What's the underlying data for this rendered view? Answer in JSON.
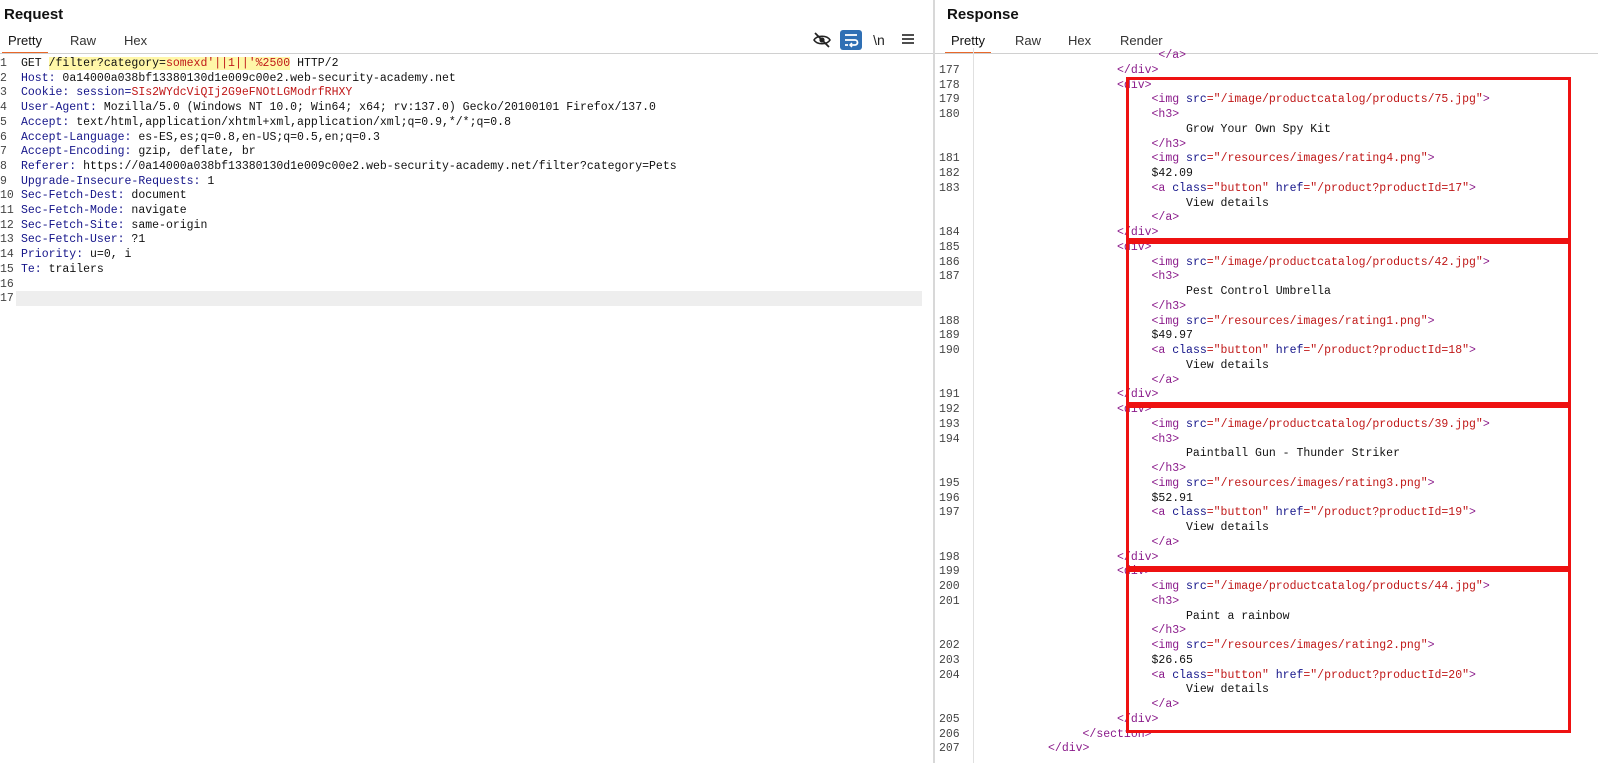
{
  "request": {
    "title": "Request",
    "tabs": [
      "Pretty",
      "Raw",
      "Hex"
    ],
    "active_tab": "Pretty",
    "tools": {
      "hide_icon": "eye-slash-icon",
      "wrap_icon": "wrap-lines-icon",
      "newline_label": "\\n",
      "menu_icon": "hamburger-menu-icon"
    },
    "lines": [
      {
        "n": "1",
        "parts": [
          {
            "t": "GET ",
            "c": "v"
          },
          {
            "t": "/filter?category=",
            "c": "v hi"
          },
          {
            "t": "somexd'||1||'%2500",
            "c": "r hi"
          },
          {
            "t": " HTTP/2",
            "c": "v"
          }
        ]
      },
      {
        "n": "2",
        "parts": [
          {
            "t": "Host:",
            "c": "k"
          },
          {
            "t": " 0a14000a038bf13380130d1e009c00e2.web-security-academy.net",
            "c": "v"
          }
        ]
      },
      {
        "n": "3",
        "parts": [
          {
            "t": "Cookie:",
            "c": "k"
          },
          {
            "t": " session=",
            "c": "k"
          },
          {
            "t": "SIs2WYdcViQIj2G9eFNOtLGModrfRHXY",
            "c": "r"
          }
        ]
      },
      {
        "n": "4",
        "parts": [
          {
            "t": "User-Agent:",
            "c": "k"
          },
          {
            "t": " Mozilla/5.0 (Windows NT 10.0; Win64; x64; rv:137.0) Gecko/20100101 Firefox/137.0",
            "c": "v"
          }
        ]
      },
      {
        "n": "5",
        "parts": [
          {
            "t": "Accept:",
            "c": "k"
          },
          {
            "t": " text/html,application/xhtml+xml,application/xml;q=0.9,*/*;q=0.8",
            "c": "v"
          }
        ]
      },
      {
        "n": "6",
        "parts": [
          {
            "t": "Accept-Language:",
            "c": "k"
          },
          {
            "t": " es-ES,es;q=0.8,en-US;q=0.5,en;q=0.3",
            "c": "v"
          }
        ]
      },
      {
        "n": "7",
        "parts": [
          {
            "t": "Accept-Encoding:",
            "c": "k"
          },
          {
            "t": " gzip, deflate, br",
            "c": "v"
          }
        ]
      },
      {
        "n": "8",
        "parts": [
          {
            "t": "Referer:",
            "c": "k"
          },
          {
            "t": " https://0a14000a038bf13380130d1e009c00e2.web-security-academy.net/filter?category=Pets",
            "c": "v"
          }
        ]
      },
      {
        "n": "9",
        "parts": [
          {
            "t": "Upgrade-Insecure-Requests:",
            "c": "k"
          },
          {
            "t": " 1",
            "c": "v"
          }
        ]
      },
      {
        "n": "10",
        "parts": [
          {
            "t": "Sec-Fetch-Dest:",
            "c": "k"
          },
          {
            "t": " document",
            "c": "v"
          }
        ]
      },
      {
        "n": "11",
        "parts": [
          {
            "t": "Sec-Fetch-Mode:",
            "c": "k"
          },
          {
            "t": " navigate",
            "c": "v"
          }
        ]
      },
      {
        "n": "12",
        "parts": [
          {
            "t": "Sec-Fetch-Site:",
            "c": "k"
          },
          {
            "t": " same-origin",
            "c": "v"
          }
        ]
      },
      {
        "n": "13",
        "parts": [
          {
            "t": "Sec-Fetch-User:",
            "c": "k"
          },
          {
            "t": " ?1",
            "c": "v"
          }
        ]
      },
      {
        "n": "14",
        "parts": [
          {
            "t": "Priority:",
            "c": "k"
          },
          {
            "t": " u=0, i",
            "c": "v"
          }
        ]
      },
      {
        "n": "15",
        "parts": [
          {
            "t": "Te:",
            "c": "k"
          },
          {
            "t": " trailers",
            "c": "v"
          }
        ]
      },
      {
        "n": "16",
        "parts": []
      },
      {
        "n": "17",
        "parts": []
      }
    ]
  },
  "response": {
    "title": "Response",
    "tabs": [
      "Pretty",
      "Raw",
      "Hex",
      "Render"
    ],
    "active_tab": "Pretty",
    "lines": [
      {
        "n": "",
        "parts": [
          {
            "t": "                          </",
            "c": "tag"
          },
          {
            "t": "a",
            "c": "tag"
          },
          {
            "t": ">",
            "c": "tag"
          }
        ]
      },
      {
        "n": "177",
        "parts": [
          {
            "t": "                    </div>",
            "c": "tag"
          }
        ]
      },
      {
        "n": "178",
        "parts": [
          {
            "t": "                    <div>",
            "c": "tag"
          }
        ]
      },
      {
        "n": "179",
        "parts": [
          {
            "t": "                         <img ",
            "c": "tag"
          },
          {
            "t": "src",
            "c": "att"
          },
          {
            "t": "=\"/image/productcatalog/products/75.jpg\"",
            "c": "str"
          },
          {
            "t": ">",
            "c": "tag"
          }
        ]
      },
      {
        "n": "180",
        "parts": [
          {
            "t": "                         <h3>",
            "c": "tag"
          }
        ]
      },
      {
        "n": "",
        "parts": [
          {
            "t": "                              Grow Your Own Spy Kit",
            "c": "v"
          }
        ]
      },
      {
        "n": "",
        "parts": [
          {
            "t": "                         </h3>",
            "c": "tag"
          }
        ]
      },
      {
        "n": "181",
        "parts": [
          {
            "t": "                         <img ",
            "c": "tag"
          },
          {
            "t": "src",
            "c": "att"
          },
          {
            "t": "=\"/resources/images/rating4.png\"",
            "c": "str"
          },
          {
            "t": ">",
            "c": "tag"
          }
        ]
      },
      {
        "n": "182",
        "parts": [
          {
            "t": "                         $42.09",
            "c": "v"
          }
        ]
      },
      {
        "n": "183",
        "parts": [
          {
            "t": "                         <a ",
            "c": "tag"
          },
          {
            "t": "class",
            "c": "att"
          },
          {
            "t": "=\"button\" ",
            "c": "str"
          },
          {
            "t": "href",
            "c": "att"
          },
          {
            "t": "=\"/product?productId=17\"",
            "c": "str"
          },
          {
            "t": ">",
            "c": "tag"
          }
        ]
      },
      {
        "n": "",
        "parts": [
          {
            "t": "                              View details",
            "c": "v"
          }
        ]
      },
      {
        "n": "",
        "parts": [
          {
            "t": "                         </a>",
            "c": "tag"
          }
        ]
      },
      {
        "n": "184",
        "parts": [
          {
            "t": "                    </div>",
            "c": "tag"
          }
        ]
      },
      {
        "n": "185",
        "parts": [
          {
            "t": "                    <div>",
            "c": "tag"
          }
        ]
      },
      {
        "n": "186",
        "parts": [
          {
            "t": "                         <img ",
            "c": "tag"
          },
          {
            "t": "src",
            "c": "att"
          },
          {
            "t": "=\"/image/productcatalog/products/42.jpg\"",
            "c": "str"
          },
          {
            "t": ">",
            "c": "tag"
          }
        ]
      },
      {
        "n": "187",
        "parts": [
          {
            "t": "                         <h3>",
            "c": "tag"
          }
        ]
      },
      {
        "n": "",
        "parts": [
          {
            "t": "                              Pest Control Umbrella",
            "c": "v"
          }
        ]
      },
      {
        "n": "",
        "parts": [
          {
            "t": "                         </h3>",
            "c": "tag"
          }
        ]
      },
      {
        "n": "188",
        "parts": [
          {
            "t": "                         <img ",
            "c": "tag"
          },
          {
            "t": "src",
            "c": "att"
          },
          {
            "t": "=\"/resources/images/rating1.png\"",
            "c": "str"
          },
          {
            "t": ">",
            "c": "tag"
          }
        ]
      },
      {
        "n": "189",
        "parts": [
          {
            "t": "                         $49.97",
            "c": "v"
          }
        ]
      },
      {
        "n": "190",
        "parts": [
          {
            "t": "                         <a ",
            "c": "tag"
          },
          {
            "t": "class",
            "c": "att"
          },
          {
            "t": "=\"button\" ",
            "c": "str"
          },
          {
            "t": "href",
            "c": "att"
          },
          {
            "t": "=\"/product?productId=18\"",
            "c": "str"
          },
          {
            "t": ">",
            "c": "tag"
          }
        ]
      },
      {
        "n": "",
        "parts": [
          {
            "t": "                              View details",
            "c": "v"
          }
        ]
      },
      {
        "n": "",
        "parts": [
          {
            "t": "                         </a>",
            "c": "tag"
          }
        ]
      },
      {
        "n": "191",
        "parts": [
          {
            "t": "                    </div>",
            "c": "tag"
          }
        ]
      },
      {
        "n": "192",
        "parts": [
          {
            "t": "                    <div>",
            "c": "tag"
          }
        ]
      },
      {
        "n": "193",
        "parts": [
          {
            "t": "                         <img ",
            "c": "tag"
          },
          {
            "t": "src",
            "c": "att"
          },
          {
            "t": "=\"/image/productcatalog/products/39.jpg\"",
            "c": "str"
          },
          {
            "t": ">",
            "c": "tag"
          }
        ]
      },
      {
        "n": "194",
        "parts": [
          {
            "t": "                         <h3>",
            "c": "tag"
          }
        ]
      },
      {
        "n": "",
        "parts": [
          {
            "t": "                              Paintball Gun - Thunder Striker",
            "c": "v"
          }
        ]
      },
      {
        "n": "",
        "parts": [
          {
            "t": "                         </h3>",
            "c": "tag"
          }
        ]
      },
      {
        "n": "195",
        "parts": [
          {
            "t": "                         <img ",
            "c": "tag"
          },
          {
            "t": "src",
            "c": "att"
          },
          {
            "t": "=\"/resources/images/rating3.png\"",
            "c": "str"
          },
          {
            "t": ">",
            "c": "tag"
          }
        ]
      },
      {
        "n": "196",
        "parts": [
          {
            "t": "                         $52.91",
            "c": "v"
          }
        ]
      },
      {
        "n": "197",
        "parts": [
          {
            "t": "                         <a ",
            "c": "tag"
          },
          {
            "t": "class",
            "c": "att"
          },
          {
            "t": "=\"button\" ",
            "c": "str"
          },
          {
            "t": "href",
            "c": "att"
          },
          {
            "t": "=\"/product?productId=19\"",
            "c": "str"
          },
          {
            "t": ">",
            "c": "tag"
          }
        ]
      },
      {
        "n": "",
        "parts": [
          {
            "t": "                              View details",
            "c": "v"
          }
        ]
      },
      {
        "n": "",
        "parts": [
          {
            "t": "                         </a>",
            "c": "tag"
          }
        ]
      },
      {
        "n": "198",
        "parts": [
          {
            "t": "                    </div>",
            "c": "tag"
          }
        ]
      },
      {
        "n": "199",
        "parts": [
          {
            "t": "                    <div>",
            "c": "tag"
          }
        ]
      },
      {
        "n": "200",
        "parts": [
          {
            "t": "                         <img ",
            "c": "tag"
          },
          {
            "t": "src",
            "c": "att"
          },
          {
            "t": "=\"/image/productcatalog/products/44.jpg\"",
            "c": "str"
          },
          {
            "t": ">",
            "c": "tag"
          }
        ]
      },
      {
        "n": "201",
        "parts": [
          {
            "t": "                         <h3>",
            "c": "tag"
          }
        ]
      },
      {
        "n": "",
        "parts": [
          {
            "t": "                              Paint a rainbow",
            "c": "v"
          }
        ]
      },
      {
        "n": "",
        "parts": [
          {
            "t": "                         </h3>",
            "c": "tag"
          }
        ]
      },
      {
        "n": "202",
        "parts": [
          {
            "t": "                         <img ",
            "c": "tag"
          },
          {
            "t": "src",
            "c": "att"
          },
          {
            "t": "=\"/resources/images/rating2.png\"",
            "c": "str"
          },
          {
            "t": ">",
            "c": "tag"
          }
        ]
      },
      {
        "n": "203",
        "parts": [
          {
            "t": "                         $26.65",
            "c": "v"
          }
        ]
      },
      {
        "n": "204",
        "parts": [
          {
            "t": "                         <a ",
            "c": "tag"
          },
          {
            "t": "class",
            "c": "att"
          },
          {
            "t": "=\"button\" ",
            "c": "str"
          },
          {
            "t": "href",
            "c": "att"
          },
          {
            "t": "=\"/product?productId=20\"",
            "c": "str"
          },
          {
            "t": ">",
            "c": "tag"
          }
        ]
      },
      {
        "n": "",
        "parts": [
          {
            "t": "                              View details",
            "c": "v"
          }
        ]
      },
      {
        "n": "",
        "parts": [
          {
            "t": "                         </a>",
            "c": "tag"
          }
        ]
      },
      {
        "n": "205",
        "parts": [
          {
            "t": "                    </div>",
            "c": "tag"
          }
        ]
      },
      {
        "n": "206",
        "parts": [
          {
            "t": "               </section>",
            "c": "tag"
          }
        ]
      },
      {
        "n": "207",
        "parts": [
          {
            "t": "          </div>",
            "c": "tag"
          }
        ]
      }
    ]
  },
  "colors": {
    "accent_tab": "#e8682a",
    "highlight_box": "#ee1111",
    "wrap_button": "#2f6fb4"
  }
}
